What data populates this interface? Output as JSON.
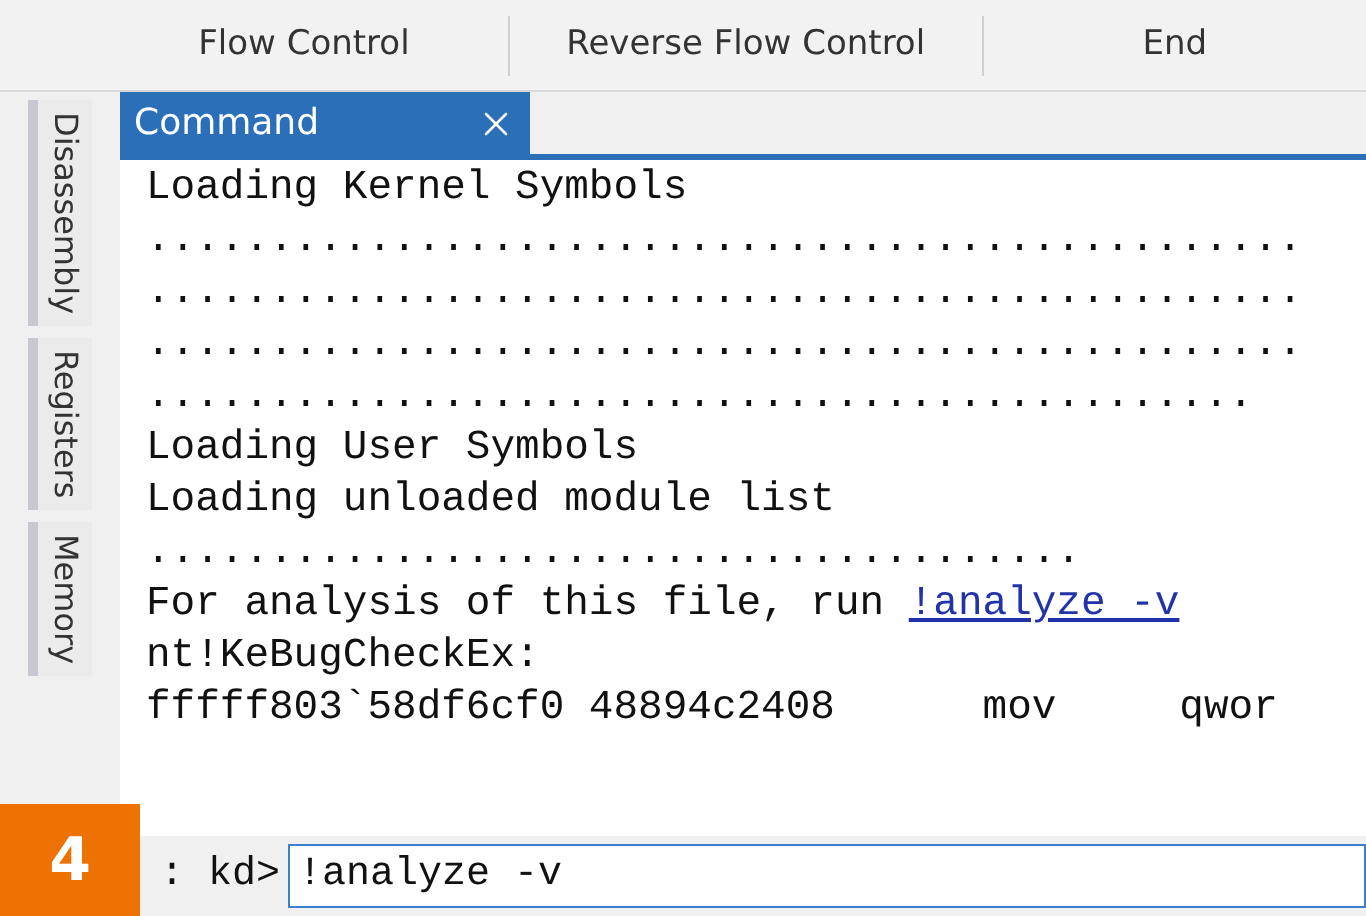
{
  "toolbar": {
    "groups": [
      "Flow Control",
      "Reverse Flow Control",
      "End"
    ]
  },
  "side_tabs": [
    "Disassembly",
    "Registers",
    "Memory"
  ],
  "command_tab": {
    "title": "Command"
  },
  "output": [
    {
      "kind": "text",
      "text": "Loading Kernel Symbols"
    },
    {
      "kind": "text",
      "text": "..............................................."
    },
    {
      "kind": "text",
      "text": "..............................................."
    },
    {
      "kind": "text",
      "text": "..............................................."
    },
    {
      "kind": "text",
      "text": "............................................."
    },
    {
      "kind": "text",
      "text": "Loading User Symbols"
    },
    {
      "kind": "text",
      "text": "Loading unloaded module list"
    },
    {
      "kind": "text",
      "text": "......................................"
    },
    {
      "kind": "hint",
      "text": "For analysis of this file, run ",
      "link": "!analyze -v"
    },
    {
      "kind": "text",
      "text": "nt!KeBugCheckEx:"
    },
    {
      "kind": "text",
      "text": "fffff803`58df6cf0 48894c2408      mov     qwor"
    }
  ],
  "prompt": {
    "label": ": kd>",
    "value": "!analyze -v"
  },
  "figure_badge": "4"
}
